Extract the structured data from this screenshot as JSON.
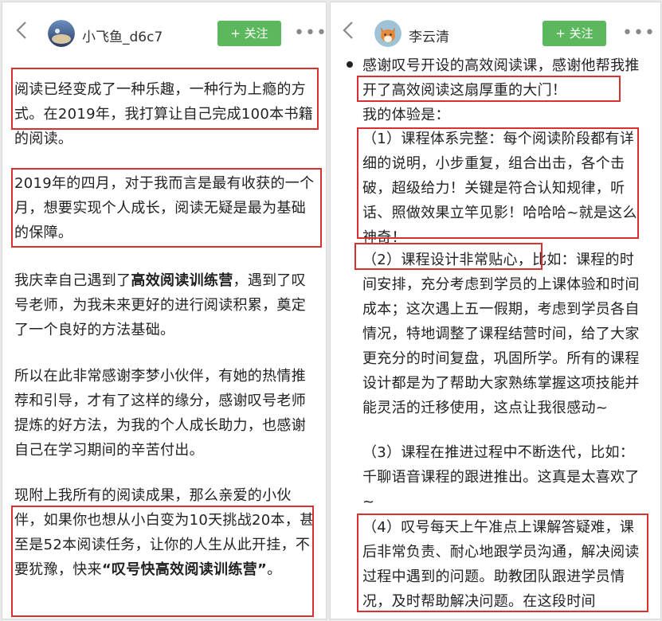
{
  "left": {
    "username": "小飞鱼_d6c7",
    "follow_label": "+ 关注",
    "more_label": "•••",
    "paragraphs": {
      "p1": "阅读已经变成了一种乐趣，一种行为上瘾的方式。在2019年，我打算让自己完成100本书籍的阅读。",
      "p2": "2019年的四月，对于我而言是最有收获的一个月，想要实现个人成长，阅读无疑是最为基础的保障。",
      "p3a": "我庆幸自己遇到了",
      "p3b": "高效阅读训练营",
      "p3c": "，遇到了叹号老师，为我未来更好的进行阅读积累，奠定了一个良好的方法基础。",
      "p4": "所以在此非常感谢李梦小伙伴，有她的热情推荐和引导，才有了这样的缘分，感谢叹号老师提炼的好方法，为我的个人成长助力，也感谢自己在学习期间的辛苦付出。",
      "p5a": "现附上我所有的阅读成果，那么亲爱的小伙伴，如果你也想从小白变为10天挑战20本，甚至是52本阅读任务，让你的人生从此开挂，不要犹豫，快来",
      "p5b": "“叹号快高效阅读训练营”",
      "p5c": "。"
    }
  },
  "right": {
    "username": "李云清",
    "follow_label": "+ 关注",
    "more_label": "•••",
    "paragraphs": {
      "intro": "感谢叹号开设的高效阅读课，感谢他帮我推开了高效阅读这扇厚重的大门！",
      "exp": "我的体验是：",
      "i1": "（1）课程体系完整：每个阅读阶段都有详细的说明，小步重复，组合出击，各个击破，超级给力！关键是符合认知规律，听话、照做效果立竿见影！哈哈哈~就是这么神奇！",
      "i2a": "（2）课程设计非常贴心，",
      "i2b": "比如：课程的时间安排，充分考虑到学员的上课体验和时间成本；这次遇上五一假期，考虑到学员各自情况，特地调整了课程结营时间，给了大家更充分的时间复盘，巩固所学。所有的课程设计都是为了帮助大家熟练掌握这项技能并能灵活的迁移使用，这点让我很感动~",
      "i3": "（3）课程在推进过程中不断迭代，比如：千聊语音课程的跟进推出。这真是太喜欢了~",
      "i4": "（4）叹号每天上午准点上课解答疑难，课后非常负责、耐心地跟学员沟通，解决阅读过程中遇到的问题。助教团队跟进学员情况，及时帮助解决问题。在这段时间"
    }
  },
  "colors": {
    "accent_green": "#5cb85c",
    "highlight_red": "#d93030"
  }
}
